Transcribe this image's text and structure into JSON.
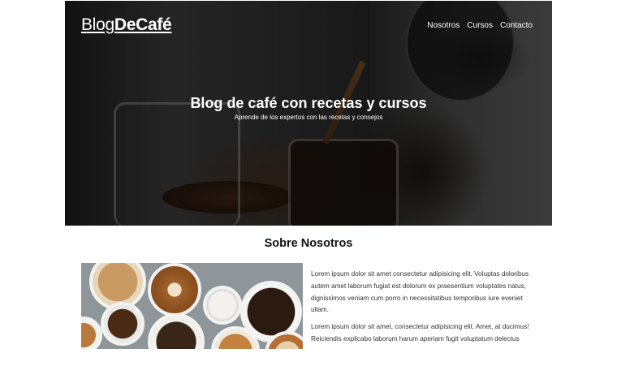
{
  "header": {
    "logo_light": "Blog",
    "logo_bold": "DeCafé",
    "nav": [
      "Nosotros",
      "Cursos",
      "Contacto"
    ]
  },
  "hero": {
    "title": "Blog de café con recetas y cursos",
    "subtitle": "Aprende de los expertos con las recetas y consejos"
  },
  "about": {
    "title": "Sobre Nosotros",
    "paragraphs": [
      "Lorem ipsum dolor sit amet consectetur adipisicing elit. Voluptas doloribus autem amet laborum fugiat est dolorum ex praesentium voluptates natus, dignissimos veniam cum porro in necessitatibus temporibus iure eveniet ullam.",
      "Lorem ipsum dolor sit amet, consectetur adipisicing elit. Amet, at ducimus! Reiciendis explicabo laborum harum aperiam fugit voluptatum delectus"
    ]
  }
}
